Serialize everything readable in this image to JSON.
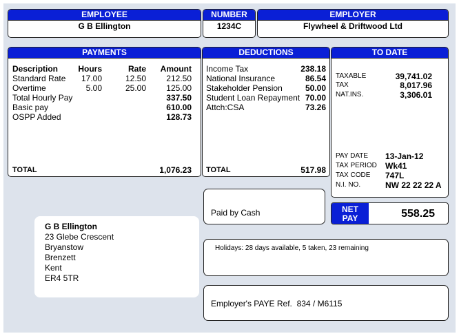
{
  "header": {
    "employee_label": "EMPLOYEE",
    "employee_name": "G B Ellington",
    "number_label": "NUMBER",
    "number_value": "1234C",
    "employer_label": "EMPLOYER",
    "employer_name": "Flywheel & Driftwood Ltd"
  },
  "payments": {
    "title": "PAYMENTS",
    "columns": [
      "Description",
      "Hours",
      "Rate",
      "Amount"
    ],
    "rows": [
      {
        "description": "Standard Rate",
        "hours": "17.00",
        "rate": "12.50",
        "amount": "212.50"
      },
      {
        "description": "Overtime",
        "hours": "5.00",
        "rate": "25.00",
        "amount": "125.00"
      },
      {
        "description": "Total Hourly Pay",
        "hours": "",
        "rate": "",
        "amount": "337.50"
      },
      {
        "description": "Basic pay",
        "hours": "",
        "rate": "",
        "amount": "610.00"
      },
      {
        "description": "OSPP Added",
        "hours": "",
        "rate": "",
        "amount": "128.73"
      }
    ],
    "total_label": "TOTAL",
    "total_value": "1,076.23"
  },
  "deductions": {
    "title": "DEDUCTIONS",
    "rows": [
      {
        "description": "Income Tax",
        "amount": "238.18"
      },
      {
        "description": "National Insurance",
        "amount": "86.54"
      },
      {
        "description": "Stakeholder Pension",
        "amount": "50.00"
      },
      {
        "description": "Student Loan Repayment",
        "amount": "70.00"
      },
      {
        "description": "Attch:CSA",
        "amount": "73.26"
      }
    ],
    "total_label": "TOTAL",
    "total_value": "517.98"
  },
  "to_date": {
    "title": "TO DATE",
    "rows": [
      {
        "label": "TAXABLE",
        "value": "39,741.02"
      },
      {
        "label": "TAX",
        "value": "8,017.96"
      },
      {
        "label": "NAT.INS.",
        "value": "3,306.01"
      }
    ],
    "info": [
      {
        "label": "PAY DATE",
        "value": "13-Jan-12"
      },
      {
        "label": "TAX PERIOD",
        "value": "Wk41"
      },
      {
        "label": "TAX CODE",
        "value": "747L"
      },
      {
        "label": "N.I. NO.",
        "value": "NW 22 22 22 A"
      }
    ]
  },
  "payment_method": {
    "label": "Paid by",
    "value": "Cash"
  },
  "net_pay": {
    "label_line1": "NET",
    "label_line2": "PAY",
    "value": "558.25"
  },
  "address": {
    "lines": [
      "G B Ellington",
      "23 Glebe Crescent",
      "Bryanstow",
      "Brenzett",
      "Kent",
      "ER4 5TR"
    ]
  },
  "holidays": {
    "text": "Holidays: 28 days available, 5 taken, 23 remaining"
  },
  "paye": {
    "label": "Employer's PAYE Ref.",
    "value": "834 / M6115"
  },
  "colors": {
    "header_blue": "#0a1fd6",
    "background": "#dde3ec"
  }
}
